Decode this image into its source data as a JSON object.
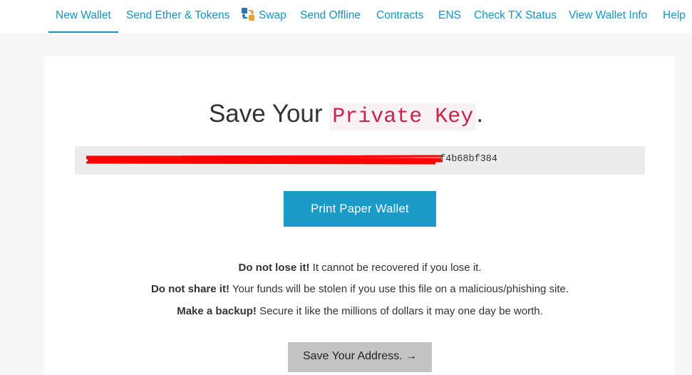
{
  "nav": {
    "items": [
      {
        "label": "New Wallet",
        "active": true
      },
      {
        "label": "Send Ether & Tokens"
      },
      {
        "label": "Swap",
        "icon": "swap-icon"
      },
      {
        "label": "Send Offline"
      },
      {
        "label": "Contracts"
      },
      {
        "label": "ENS"
      },
      {
        "label": "Check TX Status"
      },
      {
        "label": "View Wallet Info"
      },
      {
        "label": "Help"
      }
    ]
  },
  "main": {
    "title_prefix": "Save Your ",
    "title_code": "Private Key",
    "title_suffix": ".",
    "private_key_visible": "f4b68bf384",
    "print_button": "Print Paper Wallet",
    "warnings": [
      {
        "bold": "Do not lose it!",
        "text": " It cannot be recovered if you lose it."
      },
      {
        "bold": "Do not share it!",
        "text": " Your funds will be stolen if you use this file on a malicious/phishing site."
      },
      {
        "bold": "Make a backup!",
        "text": " Secure it like the millions of dollars it may one day be worth."
      }
    ],
    "save_address_button": "Save Your Address. →"
  },
  "colors": {
    "accent": "#0e97c0",
    "button_primary": "#1a9bc7",
    "code_text": "#c7254e",
    "redaction": "#ff0000"
  }
}
